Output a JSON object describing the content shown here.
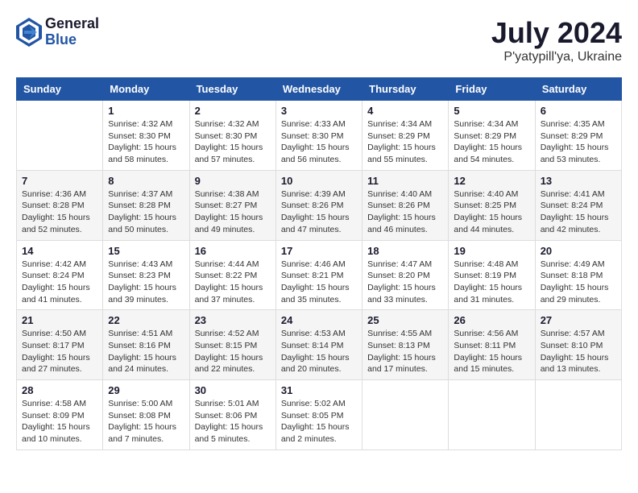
{
  "logo": {
    "general": "General",
    "blue": "Blue"
  },
  "title": "July 2024",
  "subtitle": "P'yatypill'ya, Ukraine",
  "days_of_week": [
    "Sunday",
    "Monday",
    "Tuesday",
    "Wednesday",
    "Thursday",
    "Friday",
    "Saturday"
  ],
  "weeks": [
    [
      {
        "day": "",
        "info": ""
      },
      {
        "day": "1",
        "info": "Sunrise: 4:32 AM\nSunset: 8:30 PM\nDaylight: 15 hours\nand 58 minutes."
      },
      {
        "day": "2",
        "info": "Sunrise: 4:32 AM\nSunset: 8:30 PM\nDaylight: 15 hours\nand 57 minutes."
      },
      {
        "day": "3",
        "info": "Sunrise: 4:33 AM\nSunset: 8:30 PM\nDaylight: 15 hours\nand 56 minutes."
      },
      {
        "day": "4",
        "info": "Sunrise: 4:34 AM\nSunset: 8:29 PM\nDaylight: 15 hours\nand 55 minutes."
      },
      {
        "day": "5",
        "info": "Sunrise: 4:34 AM\nSunset: 8:29 PM\nDaylight: 15 hours\nand 54 minutes."
      },
      {
        "day": "6",
        "info": "Sunrise: 4:35 AM\nSunset: 8:29 PM\nDaylight: 15 hours\nand 53 minutes."
      }
    ],
    [
      {
        "day": "7",
        "info": "Sunrise: 4:36 AM\nSunset: 8:28 PM\nDaylight: 15 hours\nand 52 minutes."
      },
      {
        "day": "8",
        "info": "Sunrise: 4:37 AM\nSunset: 8:28 PM\nDaylight: 15 hours\nand 50 minutes."
      },
      {
        "day": "9",
        "info": "Sunrise: 4:38 AM\nSunset: 8:27 PM\nDaylight: 15 hours\nand 49 minutes."
      },
      {
        "day": "10",
        "info": "Sunrise: 4:39 AM\nSunset: 8:26 PM\nDaylight: 15 hours\nand 47 minutes."
      },
      {
        "day": "11",
        "info": "Sunrise: 4:40 AM\nSunset: 8:26 PM\nDaylight: 15 hours\nand 46 minutes."
      },
      {
        "day": "12",
        "info": "Sunrise: 4:40 AM\nSunset: 8:25 PM\nDaylight: 15 hours\nand 44 minutes."
      },
      {
        "day": "13",
        "info": "Sunrise: 4:41 AM\nSunset: 8:24 PM\nDaylight: 15 hours\nand 42 minutes."
      }
    ],
    [
      {
        "day": "14",
        "info": "Sunrise: 4:42 AM\nSunset: 8:24 PM\nDaylight: 15 hours\nand 41 minutes."
      },
      {
        "day": "15",
        "info": "Sunrise: 4:43 AM\nSunset: 8:23 PM\nDaylight: 15 hours\nand 39 minutes."
      },
      {
        "day": "16",
        "info": "Sunrise: 4:44 AM\nSunset: 8:22 PM\nDaylight: 15 hours\nand 37 minutes."
      },
      {
        "day": "17",
        "info": "Sunrise: 4:46 AM\nSunset: 8:21 PM\nDaylight: 15 hours\nand 35 minutes."
      },
      {
        "day": "18",
        "info": "Sunrise: 4:47 AM\nSunset: 8:20 PM\nDaylight: 15 hours\nand 33 minutes."
      },
      {
        "day": "19",
        "info": "Sunrise: 4:48 AM\nSunset: 8:19 PM\nDaylight: 15 hours\nand 31 minutes."
      },
      {
        "day": "20",
        "info": "Sunrise: 4:49 AM\nSunset: 8:18 PM\nDaylight: 15 hours\nand 29 minutes."
      }
    ],
    [
      {
        "day": "21",
        "info": "Sunrise: 4:50 AM\nSunset: 8:17 PM\nDaylight: 15 hours\nand 27 minutes."
      },
      {
        "day": "22",
        "info": "Sunrise: 4:51 AM\nSunset: 8:16 PM\nDaylight: 15 hours\nand 24 minutes."
      },
      {
        "day": "23",
        "info": "Sunrise: 4:52 AM\nSunset: 8:15 PM\nDaylight: 15 hours\nand 22 minutes."
      },
      {
        "day": "24",
        "info": "Sunrise: 4:53 AM\nSunset: 8:14 PM\nDaylight: 15 hours\nand 20 minutes."
      },
      {
        "day": "25",
        "info": "Sunrise: 4:55 AM\nSunset: 8:13 PM\nDaylight: 15 hours\nand 17 minutes."
      },
      {
        "day": "26",
        "info": "Sunrise: 4:56 AM\nSunset: 8:11 PM\nDaylight: 15 hours\nand 15 minutes."
      },
      {
        "day": "27",
        "info": "Sunrise: 4:57 AM\nSunset: 8:10 PM\nDaylight: 15 hours\nand 13 minutes."
      }
    ],
    [
      {
        "day": "28",
        "info": "Sunrise: 4:58 AM\nSunset: 8:09 PM\nDaylight: 15 hours\nand 10 minutes."
      },
      {
        "day": "29",
        "info": "Sunrise: 5:00 AM\nSunset: 8:08 PM\nDaylight: 15 hours\nand 7 minutes."
      },
      {
        "day": "30",
        "info": "Sunrise: 5:01 AM\nSunset: 8:06 PM\nDaylight: 15 hours\nand 5 minutes."
      },
      {
        "day": "31",
        "info": "Sunrise: 5:02 AM\nSunset: 8:05 PM\nDaylight: 15 hours\nand 2 minutes."
      },
      {
        "day": "",
        "info": ""
      },
      {
        "day": "",
        "info": ""
      },
      {
        "day": "",
        "info": ""
      }
    ]
  ]
}
